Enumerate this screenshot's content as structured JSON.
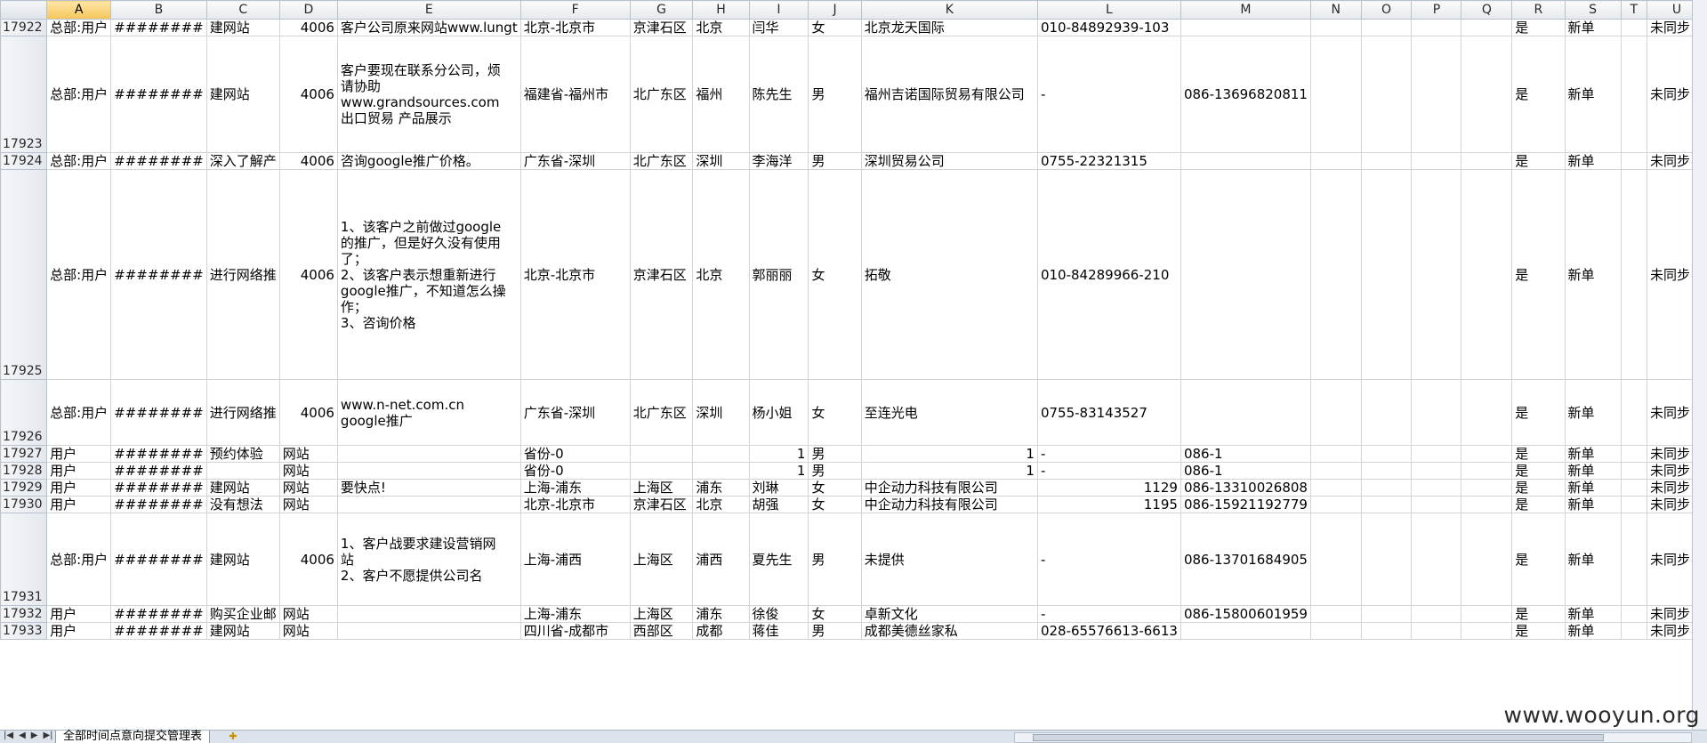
{
  "sheet": {
    "columns": [
      "A",
      "B",
      "C",
      "D",
      "E",
      "F",
      "G",
      "H",
      "I",
      "J",
      "K",
      "L",
      "M",
      "N",
      "O",
      "P",
      "Q",
      "R",
      "S",
      "T",
      "U"
    ],
    "active_column": "A",
    "rows": [
      {
        "num": "17922",
        "cells": [
          "总部:用户",
          "########",
          "建网站",
          "4006",
          "客户公司原来网站www.lungt",
          "北京-北京市",
          "京津石区",
          "北京",
          "闫华",
          "女",
          "北京龙天国际",
          "010-84892939-103",
          "",
          "",
          "",
          "",
          "",
          "是",
          "新单",
          "",
          "未同步"
        ]
      },
      {
        "num": "17923",
        "cells": [
          "总部:用户",
          "########",
          "建网站",
          "4006",
          "客户要现在联系分公司，烦\n请协助\nwww.grandsources.com\n出口贸易 产品展示",
          "福建省-福州市",
          "北广东区",
          "福州",
          "陈先生",
          "男",
          "福州吉诺国际贸易有限公司",
          "-",
          "086-13696820811",
          "",
          "",
          "",
          "",
          "是",
          "新单",
          "",
          "未同步"
        ]
      },
      {
        "num": "17924",
        "cells": [
          "总部:用户",
          "########",
          "深入了解产",
          "4006",
          "咨询google推广价格。",
          "广东省-深圳",
          "北广东区",
          "深圳",
          "李海洋",
          "男",
          "深圳贸易公司",
          "0755-22321315",
          "",
          "",
          "",
          "",
          "",
          "是",
          "新单",
          "",
          "未同步"
        ]
      },
      {
        "num": "17925",
        "cells": [
          "总部:用户",
          "########",
          "进行网络推",
          "4006",
          "1、该客户之前做过google\n的推广，但是好久没有使用\n了；\n2、该客户表示想重新进行\ngoogle推广，不知道怎么操\n作；\n3、咨询价格",
          "北京-北京市",
          "京津石区",
          "北京",
          "郭丽丽",
          "女",
          "拓敬",
          "010-84289966-210",
          "",
          "",
          "",
          "",
          "",
          "是",
          "新单",
          "",
          "未同步"
        ]
      },
      {
        "num": "17926",
        "cells": [
          "总部:用户",
          "########",
          "进行网络推",
          "4006",
          "www.n-net.com.cn\ngoogle推广",
          "广东省-深圳",
          "北广东区",
          "深圳",
          "杨小姐",
          "女",
          "至连光电",
          "0755-83143527",
          "",
          "",
          "",
          "",
          "",
          "是",
          "新单",
          "",
          "未同步"
        ]
      },
      {
        "num": "17927",
        "cells": [
          "用户",
          "########",
          "预约体验",
          "网站",
          "",
          "省份-0",
          "",
          "",
          "1",
          "男",
          "1",
          "-",
          "086-1",
          "",
          "",
          "",
          "",
          "是",
          "新单",
          "",
          "未同步"
        ]
      },
      {
        "num": "17928",
        "cells": [
          "用户",
          "########",
          "",
          "网站",
          "",
          "省份-0",
          "",
          "",
          "1",
          "男",
          "1",
          "-",
          "086-1",
          "",
          "",
          "",
          "",
          "是",
          "新单",
          "",
          "未同步"
        ]
      },
      {
        "num": "17929",
        "cells": [
          "用户",
          "########",
          "建网站",
          "网站",
          "要快点!",
          "上海-浦东",
          "上海区",
          "浦东",
          "刘琳",
          "女",
          "中企动力科技有限公司",
          "1129",
          "086-13310026808",
          "",
          "",
          "",
          "",
          "是",
          "新单",
          "",
          "未同步"
        ]
      },
      {
        "num": "17930",
        "cells": [
          "用户",
          "########",
          "没有想法",
          "网站",
          "",
          "北京-北京市",
          "京津石区",
          "北京",
          "胡强",
          "女",
          "中企动力科技有限公司",
          "1195",
          "086-15921192779",
          "",
          "",
          "",
          "",
          "是",
          "新单",
          "",
          "未同步"
        ]
      },
      {
        "num": "17931",
        "cells": [
          "总部:用户",
          "########",
          "建网站",
          "4006",
          "1、客户战要求建设营销网\n站\n2、客户不愿提供公司名",
          "上海-浦西",
          "上海区",
          "浦西",
          "夏先生",
          "男",
          "未提供",
          "-",
          "086-13701684905",
          "",
          "",
          "",
          "",
          "是",
          "新单",
          "",
          "未同步"
        ]
      },
      {
        "num": "17932",
        "cells": [
          "用户",
          "########",
          "购买企业邮",
          "网站",
          "",
          "上海-浦东",
          "上海区",
          "浦东",
          "徐俊",
          "女",
          "卓新文化",
          "-",
          "086-15800601959",
          "",
          "",
          "",
          "",
          "是",
          "新单",
          "",
          "未同步"
        ]
      },
      {
        "num": "17933",
        "cells": [
          "用户",
          "########",
          "建网站",
          "网站",
          "",
          "四川省-成都市",
          "西部区",
          "成都",
          "蒋佳",
          "男",
          "成都美德丝家私",
          "028-65576613-6613",
          "",
          "",
          "",
          "",
          "",
          "是",
          "新单",
          "",
          "未同步"
        ]
      }
    ]
  },
  "sheet_tab": {
    "label": "全部时间点意向提交管理表"
  },
  "watermark": "www.wooyun.org"
}
